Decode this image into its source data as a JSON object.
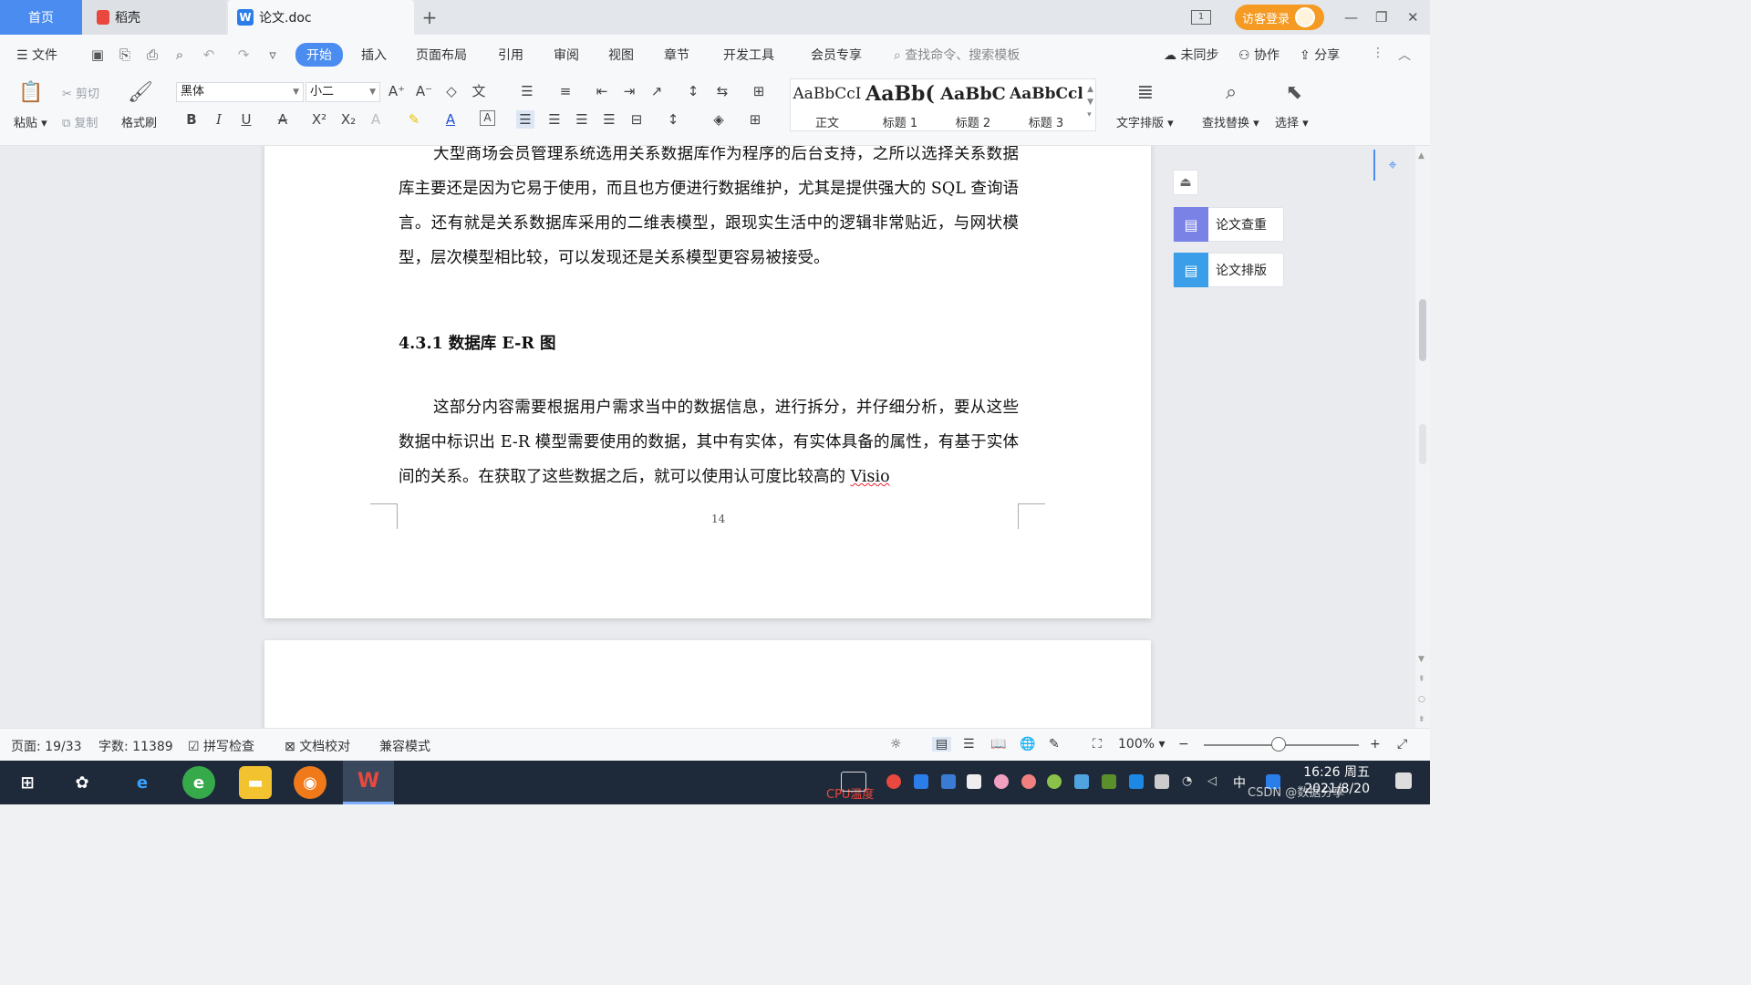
{
  "tabs": {
    "home": "首页",
    "daoke": "稻壳",
    "doc": "论文.doc",
    "add": "+"
  },
  "window": {
    "visitor_login": "访客登录",
    "minimize": "—",
    "restore": "❐",
    "close": "✕",
    "page_layout_icon": "1"
  },
  "menu": {
    "file": "文件",
    "items": [
      "开始",
      "插入",
      "页面布局",
      "引用",
      "审阅",
      "视图",
      "章节",
      "开发工具",
      "会员专享"
    ],
    "search_placeholder": "查找命令、搜索模板",
    "sync": "未同步",
    "collab": "协作",
    "share": "分享"
  },
  "ribbon": {
    "paste": "粘贴",
    "cut": "剪切",
    "copy": "复制",
    "format_painter": "格式刷",
    "font": "黑体",
    "size": "小二",
    "styles": [
      {
        "sample": "AaBbCcI",
        "label": "正文"
      },
      {
        "sample": "AaBb(",
        "label": "标题 1"
      },
      {
        "sample": "AaBbC",
        "label": "标题 2"
      },
      {
        "sample": "AaBbCcl",
        "label": "标题 3"
      }
    ],
    "text_layout": "文字排版",
    "find_replace": "查找替换",
    "select": "选择"
  },
  "document": {
    "para1": "大型商场会员管理系统选用关系数据库作为程序的后台支持，之所以选择关系数据库主要还是因为它易于使用，而且也方便进行数据维护，尤其是提供强大的 SQL 查询语言。还有就是关系数据库采用的二维表模型，跟现实生活中的逻辑非常贴近，与网状模型，层次模型相比较，可以发现还是关系模型更容易被接受。",
    "heading": "4.3.1 数据库 E-R 图",
    "para2_main": "这部分内容需要根据用户需求当中的数据信息，进行拆分，并仔细分析，要从这些数据中标识出 E-R 模型需要使用的数据，其中有实体，有实体具备的属性，有基于实体间的关系。在获取了这些数据之后，就可以使用认可度比较高的",
    "para2_last": "Visio",
    "page_number": "14"
  },
  "right_panel": {
    "check": "论文查重",
    "layout": "论文排版"
  },
  "status": {
    "page": "页面: 19/33",
    "words": "字数: 11389",
    "spell": "拼写检查",
    "proof": "文档校对",
    "compat": "兼容模式",
    "zoom": "100%"
  },
  "taskbar": {
    "time": "16:26 周五",
    "date": "2021/8/20",
    "ime": "中",
    "cpu": "CPU温度",
    "watermark": "CSDN @数据分享"
  },
  "colors": {
    "accent": "#4a8cf0",
    "visitor": "#f59a23",
    "taskbar": "#1e2a3a"
  }
}
